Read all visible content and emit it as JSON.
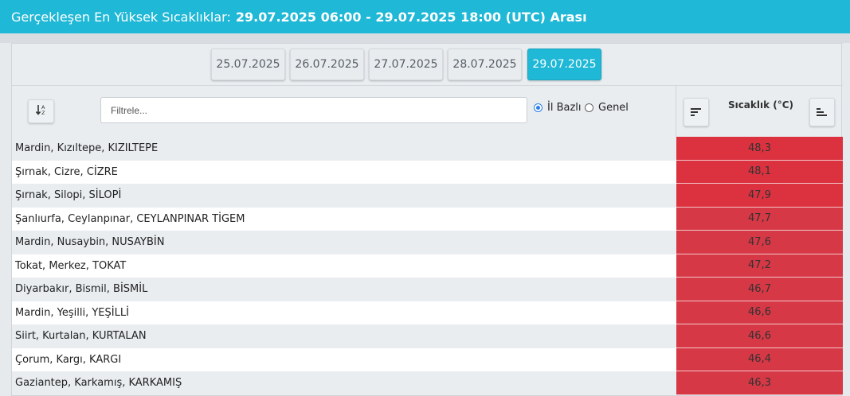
{
  "header": {
    "label": "Gerçekleşen En Yüksek Sıcaklıklar:",
    "range": "29.07.2025 06:00 - 29.07.2025 18:00 (UTC) Arası",
    "bg": "#1fb8d6"
  },
  "dates": [
    "25.07.2025",
    "26.07.2025",
    "27.07.2025",
    "28.07.2025",
    "29.07.2025"
  ],
  "active_date": "29.07.2025",
  "filter": {
    "placeholder": "Filtrele...",
    "value": ""
  },
  "scope": {
    "option1": "İl Bazlı",
    "option2": "Genel",
    "selected": "İl Bazlı"
  },
  "icons": {
    "sort_alpha": "sort-alpha-icon",
    "sort_desc": "sort-desc-icon",
    "sort_asc": "sort-asc-icon"
  },
  "column_header": "Sıcaklık (°C)",
  "colors": {
    "accent": "#1fb8d6",
    "hot": "#dc3240",
    "hot_alt": "#d63846",
    "row_alt": "#e9edf0",
    "row": "#ffffff"
  },
  "rows": [
    {
      "name": "Mardin, Kızıltepe, KIZILTEPE",
      "value": "48,3"
    },
    {
      "name": "Şırnak, Cizre, CİZRE",
      "value": "48,1"
    },
    {
      "name": "Şırnak, Silopi, SİLOPİ",
      "value": "47,9"
    },
    {
      "name": "Şanlıurfa, Ceylanpınar, CEYLANPINAR TİGEM",
      "value": "47,7"
    },
    {
      "name": "Mardin, Nusaybin, NUSAYBİN",
      "value": "47,6"
    },
    {
      "name": "Tokat, Merkez, TOKAT",
      "value": "47,2"
    },
    {
      "name": "Diyarbakır, Bismil, BİSMİL",
      "value": "46,7"
    },
    {
      "name": "Mardin, Yeşilli, YEŞİLLİ",
      "value": "46,6"
    },
    {
      "name": "Siirt, Kurtalan, KURTALAN",
      "value": "46,6"
    },
    {
      "name": "Çorum, Kargı, KARGI",
      "value": "46,4"
    },
    {
      "name": "Gaziantep, Karkamış, KARKAMIŞ",
      "value": "46,3"
    }
  ]
}
